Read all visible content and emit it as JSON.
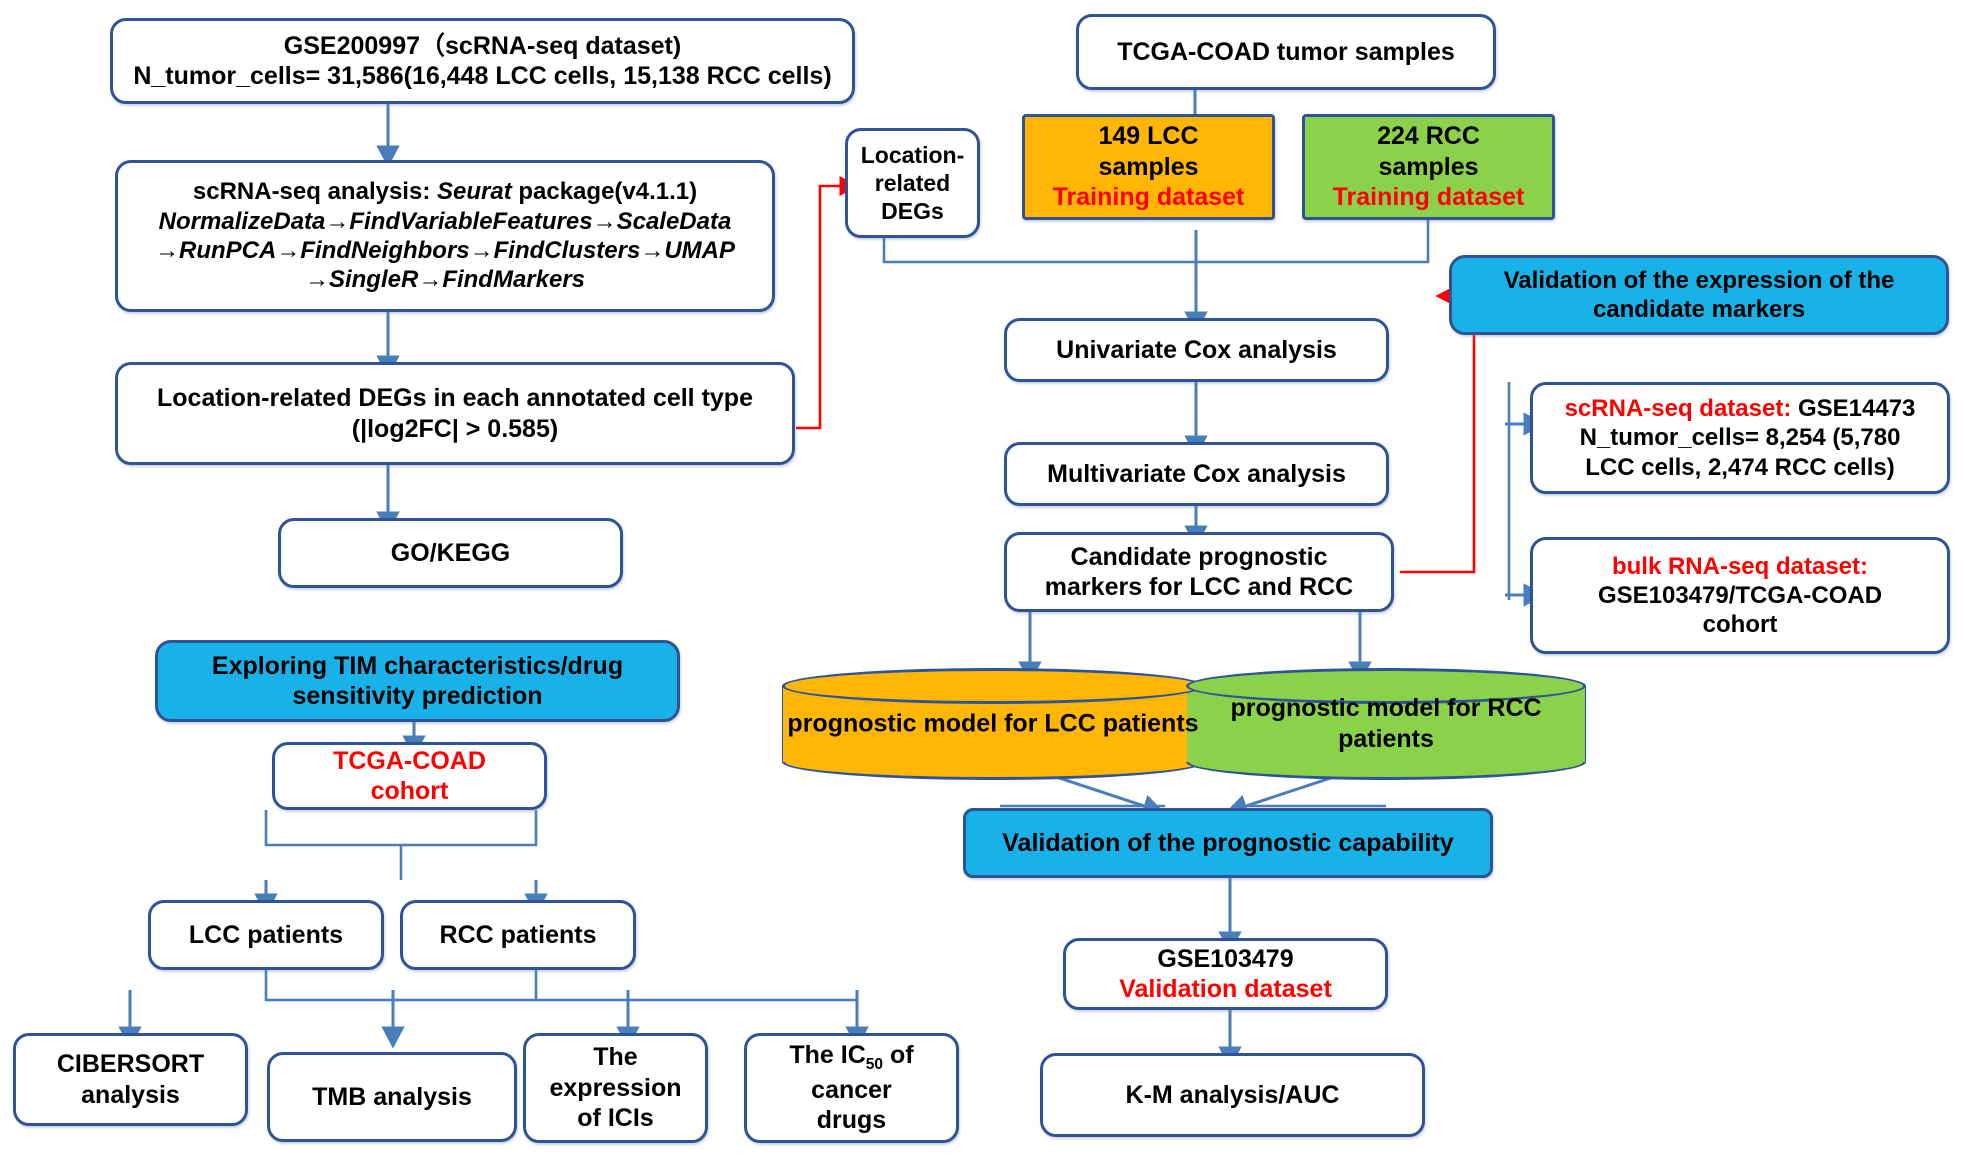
{
  "colors": {
    "border": "#2e5496",
    "arrow_blue": "#4a7ebb",
    "arrow_red": "#ff0000",
    "orange": "#ffb606",
    "green": "#8bd24a",
    "cyan": "#19b2e8",
    "red_text": "#ff0000"
  },
  "nodes": {
    "gse200997": {
      "line1": "GSE200997（scRNA-seq dataset)",
      "line2": "N_tumor_cells= 31,586(16,448 LCC cells, 15,138 RCC cells)"
    },
    "scrnaseq_analysis": {
      "line1_plain": "scRNA-seq analysis: ",
      "line1_italic": "Seurat",
      "line1_tail": " package(v4.1.1)",
      "line2": "NormalizeData→FindVariableFeatures→ScaleData",
      "line3": "→RunPCA→FindNeighbors→FindClusters→UMAP",
      "line4": "→SingleR→FindMarkers"
    },
    "location_degs_each": {
      "line1": "Location-related DEGs in each annotated cell type",
      "line2": "(|log2FC| > 0.585)"
    },
    "go_kegg": {
      "label": "GO/KEGG"
    },
    "exploring_tim": {
      "line1": "Exploring TIM characteristics/drug",
      "line2": "sensitivity prediction"
    },
    "tcga_coad_cohort": {
      "line1": "TCGA-COAD",
      "line2": "cohort"
    },
    "lcc_patients": {
      "label": "LCC patients"
    },
    "rcc_patients": {
      "label": "RCC patients"
    },
    "cibersort": {
      "line1": "CIBERSORT",
      "line2": "analysis"
    },
    "tmb": {
      "label": "TMB analysis"
    },
    "icis": {
      "line1": "The",
      "line2": "expression",
      "line3": "of ICIs"
    },
    "ic50": {
      "line1_a": "The IC",
      "line1_sub": "50",
      "line1_b": " of",
      "line2": "cancer",
      "line3": "drugs"
    },
    "tcga_tumor_samples": {
      "label": "TCGA-COAD tumor samples"
    },
    "location_degs_small": {
      "line1": "Location-",
      "line2": "related",
      "line3": "DEGs"
    },
    "lcc_samples": {
      "line1": "149 LCC",
      "line2": "samples",
      "line3": "Training dataset"
    },
    "rcc_samples": {
      "line1": "224 RCC",
      "line2": "samples",
      "line3": "Training dataset"
    },
    "univariate": {
      "label": "Univariate Cox analysis"
    },
    "multivariate": {
      "label": "Multivariate Cox analysis"
    },
    "candidate_markers": {
      "line1": "Candidate prognostic",
      "line2": "markers for LCC and RCC"
    },
    "validation_expression": {
      "line1": "Validation of the expression of the",
      "line2": "candidate markers"
    },
    "scrnaseq_validation": {
      "line1_red": "scRNA-seq dataset:",
      "line1_tail": " GSE14473",
      "line2": "N_tumor_cells= 8,254 (5,780",
      "line3": "LCC cells, 2,474 RCC cells)"
    },
    "bulk_validation": {
      "line1_red": "bulk RNA-seq dataset:",
      "line2": "GSE103479/TCGA-COAD",
      "line3": "cohort"
    },
    "model_lcc": {
      "line1": "prognostic model for LCC",
      "line2": "patients"
    },
    "model_rcc": {
      "line1": "prognostic model for RCC",
      "line2": "patients"
    },
    "validation_prognostic": {
      "label": "Validation of the prognostic capability"
    },
    "gse103479": {
      "line1": "GSE103479",
      "line2": "Validation dataset"
    },
    "km_auc": {
      "label": "K-M analysis/AUC"
    }
  }
}
